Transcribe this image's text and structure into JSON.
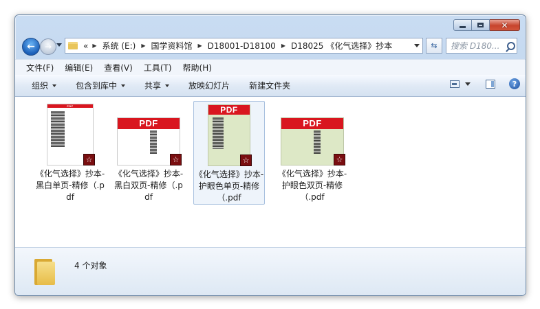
{
  "window": {
    "controls": {
      "minimize": "minimize",
      "maximize": "maximize",
      "close": "✕"
    }
  },
  "address": {
    "overflow": "«",
    "crumbs": [
      "系统 (E:)",
      "国学资料馆",
      "D18001-D18100",
      "D18025 《化气选择》抄本"
    ],
    "search_placeholder": "搜索 D180..."
  },
  "menu": [
    "文件(F)",
    "编辑(E)",
    "查看(V)",
    "工具(T)",
    "帮助(H)"
  ],
  "commands": {
    "organize": "组织",
    "include_library": "包含到库中",
    "share": "共享",
    "slideshow": "放映幻灯片",
    "new_folder": "新建文件夹"
  },
  "files": [
    {
      "name": "《化气选择》抄本-黑白单页-精修（.pdf",
      "band": "PDF",
      "page_color": "#ffffff",
      "layout": "single"
    },
    {
      "name": "《化气选择》抄本-黑白双页-精修（.pdf",
      "band": "PDF",
      "page_color": "#ffffff",
      "layout": "double"
    },
    {
      "name": "《化气选择》抄本-护眼色单页-精修（.pdf",
      "band": "PDF",
      "page_color": "#dde8c6",
      "layout": "single"
    },
    {
      "name": "《化气选择》抄本-护眼色双页-精修（.pdf",
      "band": "PDF",
      "page_color": "#dde8c6",
      "layout": "double"
    }
  ],
  "status": {
    "count": "4 个对象"
  },
  "colors": {
    "pdf_red": "#d9161f",
    "eye_care": "#dde8c6",
    "accent": "#1b5fb8"
  }
}
